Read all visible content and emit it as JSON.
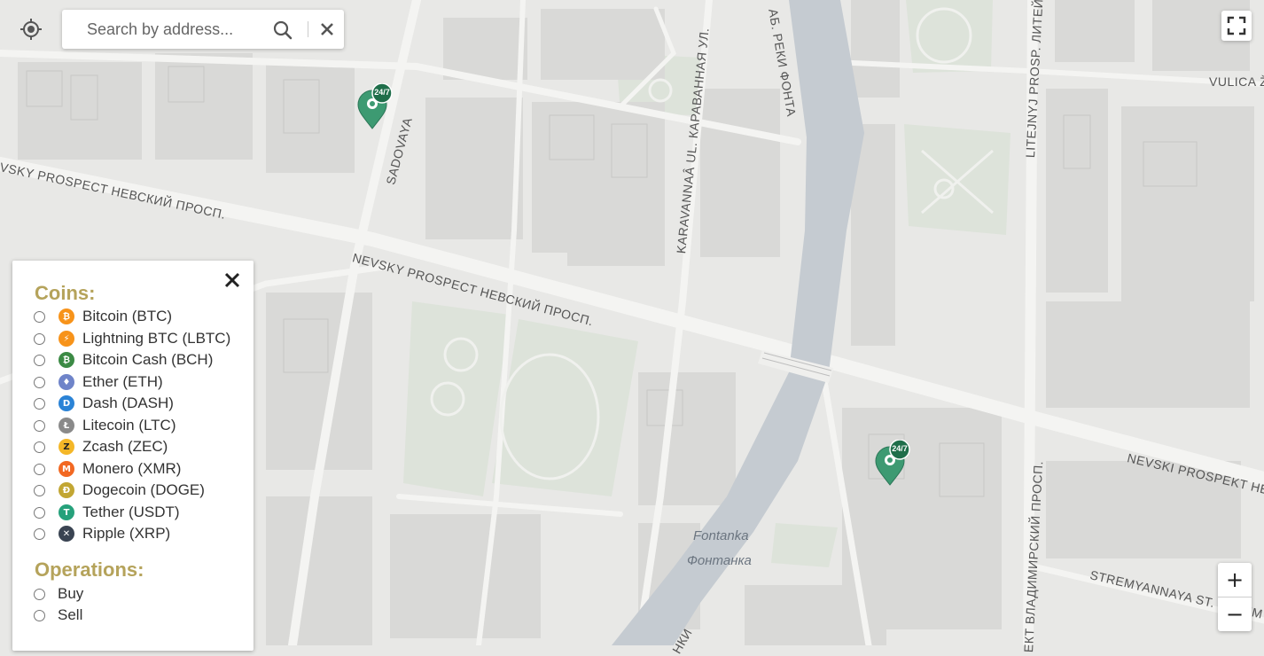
{
  "search": {
    "placeholder": "Search by address..."
  },
  "map": {
    "streets": [
      "SADOVAYA",
      "NEVSKY PROSPECT НЕВСКИЙ ПРОСП.",
      "VSKY PROSPECT НЕВСКИЙ ПРОСП.",
      "KARAVANNAÂ UL. КАРАВАННАЯ УЛ.",
      "АБ. РЕКИ ФОНТА",
      "LITEJNYJ PROSP. ЛИТЕЙ",
      "VULICA Ž",
      "NEVSKI PROSPEKT НЕ",
      "STREMYANNAYA ST. СТРЕМ",
      "ЕКТ ВЛАДИМИРСКИЙ ПРОСП.",
      "НКИ"
    ],
    "water": [
      "Fontanka",
      "Фонтанка"
    ],
    "markers": [
      {
        "badge": "24/7"
      },
      {
        "badge": "24/7"
      }
    ],
    "marker_color": "#3d9a72",
    "water_color": "#c5cbd1"
  },
  "controls": {
    "zoom_in": "+",
    "zoom_out": "−"
  },
  "filters": {
    "coins_title": "Coins:",
    "coins": [
      {
        "label": "Bitcoin (BTC)",
        "color": "#f7931a",
        "icon": "bitcoin-icon",
        "glyph": "₿"
      },
      {
        "label": "Lightning BTC (LBTC)",
        "color": "#f7931a",
        "icon": "lightning-icon",
        "glyph": "⚡"
      },
      {
        "label": "Bitcoin Cash (BCH)",
        "color": "#3c8a45",
        "icon": "bitcoin-cash-icon",
        "glyph": "₿"
      },
      {
        "label": "Ether (ETH)",
        "color": "#6f84c9",
        "icon": "ether-icon",
        "glyph": "♦"
      },
      {
        "label": "Dash (DASH)",
        "color": "#2b83d6",
        "icon": "dash-icon",
        "glyph": "D"
      },
      {
        "label": "Litecoin (LTC)",
        "color": "#8a8a8a",
        "icon": "litecoin-icon",
        "glyph": "Ł"
      },
      {
        "label": "Zcash (ZEC)",
        "color": "#f4b728",
        "icon": "zcash-icon",
        "glyph": "Z"
      },
      {
        "label": "Monero (XMR)",
        "color": "#f26822",
        "icon": "monero-icon",
        "glyph": "M"
      },
      {
        "label": "Dogecoin (DOGE)",
        "color": "#c2a633",
        "icon": "dogecoin-icon",
        "glyph": "Ð"
      },
      {
        "label": "Tether (USDT)",
        "color": "#26a17b",
        "icon": "tether-icon",
        "glyph": "T"
      },
      {
        "label": "Ripple (XRP)",
        "color": "#3a4452",
        "icon": "ripple-icon",
        "glyph": "✕"
      }
    ],
    "operations_title": "Operations:",
    "operations": [
      {
        "label": "Buy"
      },
      {
        "label": "Sell"
      }
    ]
  }
}
